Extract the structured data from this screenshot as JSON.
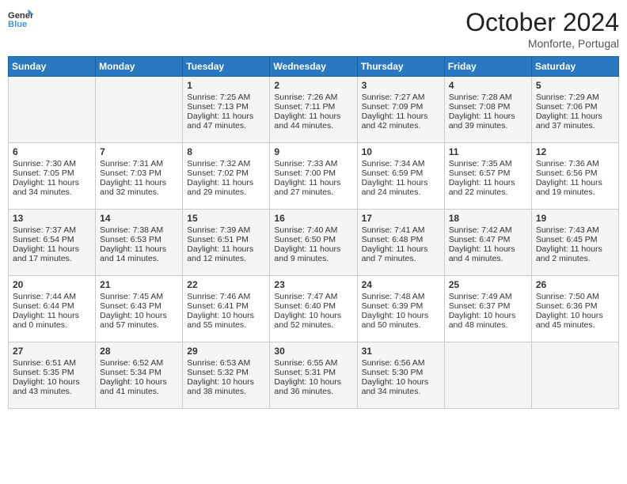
{
  "header": {
    "logo_line1": "General",
    "logo_line2": "Blue",
    "month": "October 2024",
    "location": "Monforte, Portugal"
  },
  "days_of_week": [
    "Sunday",
    "Monday",
    "Tuesday",
    "Wednesday",
    "Thursday",
    "Friday",
    "Saturday"
  ],
  "weeks": [
    [
      {
        "day": "",
        "sunrise": "",
        "sunset": "",
        "daylight": ""
      },
      {
        "day": "",
        "sunrise": "",
        "sunset": "",
        "daylight": ""
      },
      {
        "day": "1",
        "sunrise": "Sunrise: 7:25 AM",
        "sunset": "Sunset: 7:13 PM",
        "daylight": "Daylight: 11 hours and 47 minutes."
      },
      {
        "day": "2",
        "sunrise": "Sunrise: 7:26 AM",
        "sunset": "Sunset: 7:11 PM",
        "daylight": "Daylight: 11 hours and 44 minutes."
      },
      {
        "day": "3",
        "sunrise": "Sunrise: 7:27 AM",
        "sunset": "Sunset: 7:09 PM",
        "daylight": "Daylight: 11 hours and 42 minutes."
      },
      {
        "day": "4",
        "sunrise": "Sunrise: 7:28 AM",
        "sunset": "Sunset: 7:08 PM",
        "daylight": "Daylight: 11 hours and 39 minutes."
      },
      {
        "day": "5",
        "sunrise": "Sunrise: 7:29 AM",
        "sunset": "Sunset: 7:06 PM",
        "daylight": "Daylight: 11 hours and 37 minutes."
      }
    ],
    [
      {
        "day": "6",
        "sunrise": "Sunrise: 7:30 AM",
        "sunset": "Sunset: 7:05 PM",
        "daylight": "Daylight: 11 hours and 34 minutes."
      },
      {
        "day": "7",
        "sunrise": "Sunrise: 7:31 AM",
        "sunset": "Sunset: 7:03 PM",
        "daylight": "Daylight: 11 hours and 32 minutes."
      },
      {
        "day": "8",
        "sunrise": "Sunrise: 7:32 AM",
        "sunset": "Sunset: 7:02 PM",
        "daylight": "Daylight: 11 hours and 29 minutes."
      },
      {
        "day": "9",
        "sunrise": "Sunrise: 7:33 AM",
        "sunset": "Sunset: 7:00 PM",
        "daylight": "Daylight: 11 hours and 27 minutes."
      },
      {
        "day": "10",
        "sunrise": "Sunrise: 7:34 AM",
        "sunset": "Sunset: 6:59 PM",
        "daylight": "Daylight: 11 hours and 24 minutes."
      },
      {
        "day": "11",
        "sunrise": "Sunrise: 7:35 AM",
        "sunset": "Sunset: 6:57 PM",
        "daylight": "Daylight: 11 hours and 22 minutes."
      },
      {
        "day": "12",
        "sunrise": "Sunrise: 7:36 AM",
        "sunset": "Sunset: 6:56 PM",
        "daylight": "Daylight: 11 hours and 19 minutes."
      }
    ],
    [
      {
        "day": "13",
        "sunrise": "Sunrise: 7:37 AM",
        "sunset": "Sunset: 6:54 PM",
        "daylight": "Daylight: 11 hours and 17 minutes."
      },
      {
        "day": "14",
        "sunrise": "Sunrise: 7:38 AM",
        "sunset": "Sunset: 6:53 PM",
        "daylight": "Daylight: 11 hours and 14 minutes."
      },
      {
        "day": "15",
        "sunrise": "Sunrise: 7:39 AM",
        "sunset": "Sunset: 6:51 PM",
        "daylight": "Daylight: 11 hours and 12 minutes."
      },
      {
        "day": "16",
        "sunrise": "Sunrise: 7:40 AM",
        "sunset": "Sunset: 6:50 PM",
        "daylight": "Daylight: 11 hours and 9 minutes."
      },
      {
        "day": "17",
        "sunrise": "Sunrise: 7:41 AM",
        "sunset": "Sunset: 6:48 PM",
        "daylight": "Daylight: 11 hours and 7 minutes."
      },
      {
        "day": "18",
        "sunrise": "Sunrise: 7:42 AM",
        "sunset": "Sunset: 6:47 PM",
        "daylight": "Daylight: 11 hours and 4 minutes."
      },
      {
        "day": "19",
        "sunrise": "Sunrise: 7:43 AM",
        "sunset": "Sunset: 6:45 PM",
        "daylight": "Daylight: 11 hours and 2 minutes."
      }
    ],
    [
      {
        "day": "20",
        "sunrise": "Sunrise: 7:44 AM",
        "sunset": "Sunset: 6:44 PM",
        "daylight": "Daylight: 11 hours and 0 minutes."
      },
      {
        "day": "21",
        "sunrise": "Sunrise: 7:45 AM",
        "sunset": "Sunset: 6:43 PM",
        "daylight": "Daylight: 10 hours and 57 minutes."
      },
      {
        "day": "22",
        "sunrise": "Sunrise: 7:46 AM",
        "sunset": "Sunset: 6:41 PM",
        "daylight": "Daylight: 10 hours and 55 minutes."
      },
      {
        "day": "23",
        "sunrise": "Sunrise: 7:47 AM",
        "sunset": "Sunset: 6:40 PM",
        "daylight": "Daylight: 10 hours and 52 minutes."
      },
      {
        "day": "24",
        "sunrise": "Sunrise: 7:48 AM",
        "sunset": "Sunset: 6:39 PM",
        "daylight": "Daylight: 10 hours and 50 minutes."
      },
      {
        "day": "25",
        "sunrise": "Sunrise: 7:49 AM",
        "sunset": "Sunset: 6:37 PM",
        "daylight": "Daylight: 10 hours and 48 minutes."
      },
      {
        "day": "26",
        "sunrise": "Sunrise: 7:50 AM",
        "sunset": "Sunset: 6:36 PM",
        "daylight": "Daylight: 10 hours and 45 minutes."
      }
    ],
    [
      {
        "day": "27",
        "sunrise": "Sunrise: 6:51 AM",
        "sunset": "Sunset: 5:35 PM",
        "daylight": "Daylight: 10 hours and 43 minutes."
      },
      {
        "day": "28",
        "sunrise": "Sunrise: 6:52 AM",
        "sunset": "Sunset: 5:34 PM",
        "daylight": "Daylight: 10 hours and 41 minutes."
      },
      {
        "day": "29",
        "sunrise": "Sunrise: 6:53 AM",
        "sunset": "Sunset: 5:32 PM",
        "daylight": "Daylight: 10 hours and 38 minutes."
      },
      {
        "day": "30",
        "sunrise": "Sunrise: 6:55 AM",
        "sunset": "Sunset: 5:31 PM",
        "daylight": "Daylight: 10 hours and 36 minutes."
      },
      {
        "day": "31",
        "sunrise": "Sunrise: 6:56 AM",
        "sunset": "Sunset: 5:30 PM",
        "daylight": "Daylight: 10 hours and 34 minutes."
      },
      {
        "day": "",
        "sunrise": "",
        "sunset": "",
        "daylight": ""
      },
      {
        "day": "",
        "sunrise": "",
        "sunset": "",
        "daylight": ""
      }
    ]
  ]
}
